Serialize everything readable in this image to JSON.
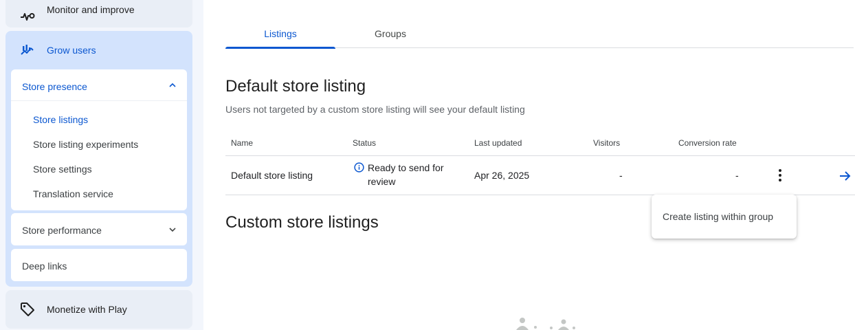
{
  "sidebar": {
    "monitor_label": "Monitor and improve",
    "grow_label": "Grow users",
    "store_presence": {
      "label": "Store presence",
      "items": [
        {
          "label": "Store listings",
          "active": true
        },
        {
          "label": "Store listing experiments",
          "active": false
        },
        {
          "label": "Store settings",
          "active": false
        },
        {
          "label": "Translation service",
          "active": false
        }
      ]
    },
    "store_performance_label": "Store performance",
    "deep_links_label": "Deep links",
    "monetize_label": "Monetize with Play"
  },
  "tabs": [
    {
      "label": "Listings",
      "active": true
    },
    {
      "label": "Groups",
      "active": false
    }
  ],
  "default_section": {
    "title": "Default store listing",
    "subtitle": "Users not targeted by a custom store listing will see your default listing"
  },
  "table": {
    "headers": {
      "name": "Name",
      "status": "Status",
      "last_updated": "Last updated",
      "visitors": "Visitors",
      "conversion_rate": "Conversion rate"
    },
    "row": {
      "name": "Default store listing",
      "status_line1": "Ready to send for",
      "status_line2": "review",
      "last_updated": "Apr 26, 2025",
      "visitors": "-",
      "conversion_rate": "-",
      "status_icon": "info-icon",
      "more_icon": "more-vert-icon",
      "arrow_icon": "arrow-forward-icon"
    }
  },
  "custom_section": {
    "title": "Custom store listings"
  },
  "popup_menu": {
    "items": [
      "Create listing within group"
    ]
  },
  "colors": {
    "accent": "#0b57d0",
    "active_group_bg": "#d3e3fd",
    "sidebar_bg": "#f3f6fc"
  }
}
